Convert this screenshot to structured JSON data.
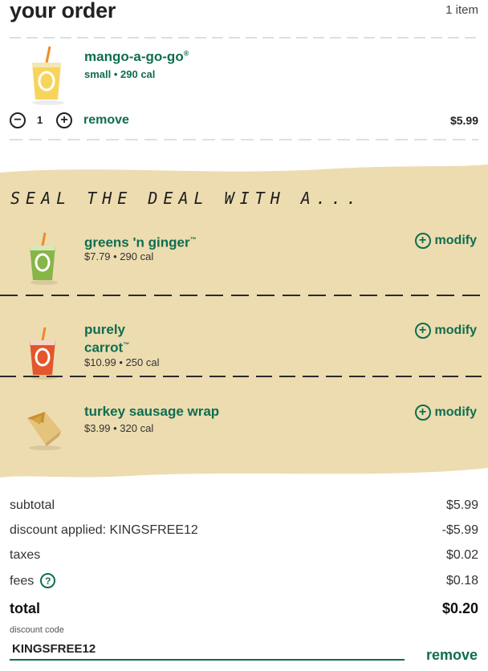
{
  "header": {
    "title": "your order",
    "item_count": "1 item"
  },
  "order_item": {
    "name": "mango-a-go-go",
    "trademark": "®",
    "meta": "small • 290 cal",
    "quantity": "1",
    "decrement_symbol": "−",
    "increment_symbol": "+",
    "remove_label": "remove",
    "price": "$5.99",
    "icon": "smoothie-cup-yellow"
  },
  "upsell": {
    "heading": "SEAL THE DEAL WITH A...",
    "items": [
      {
        "name_line1": "greens 'n ginger",
        "name_line2": "",
        "trademark": "™",
        "meta": "$7.79 • 290 cal",
        "modify_label": "modify",
        "icon": "smoothie-cup-green"
      },
      {
        "name_line1": "purely",
        "name_line2": "carrot",
        "trademark": "™",
        "meta": "$10.99 • 250 cal",
        "modify_label": "modify",
        "icon": "smoothie-cup-orange"
      },
      {
        "name_line1": "turkey sausage wrap",
        "name_line2": "",
        "trademark": "",
        "meta": "$3.99 • 320 cal",
        "modify_label": "modify",
        "icon": "wrap"
      }
    ]
  },
  "summary": {
    "subtotal_label": "subtotal",
    "subtotal_value": "$5.99",
    "discount_label": "discount applied: KINGSFREE12",
    "discount_value": "-$5.99",
    "taxes_label": "taxes",
    "taxes_value": "$0.02",
    "fees_label": "fees",
    "fees_help": "?",
    "fees_value": "$0.18",
    "total_label": "total",
    "total_value": "$0.20"
  },
  "discount_code": {
    "label": "discount code",
    "value": "KINGSFREE12",
    "remove_label": "remove"
  },
  "colors": {
    "brand_green": "#0f6d4f",
    "upsell_bg": "#ecdcb0"
  }
}
